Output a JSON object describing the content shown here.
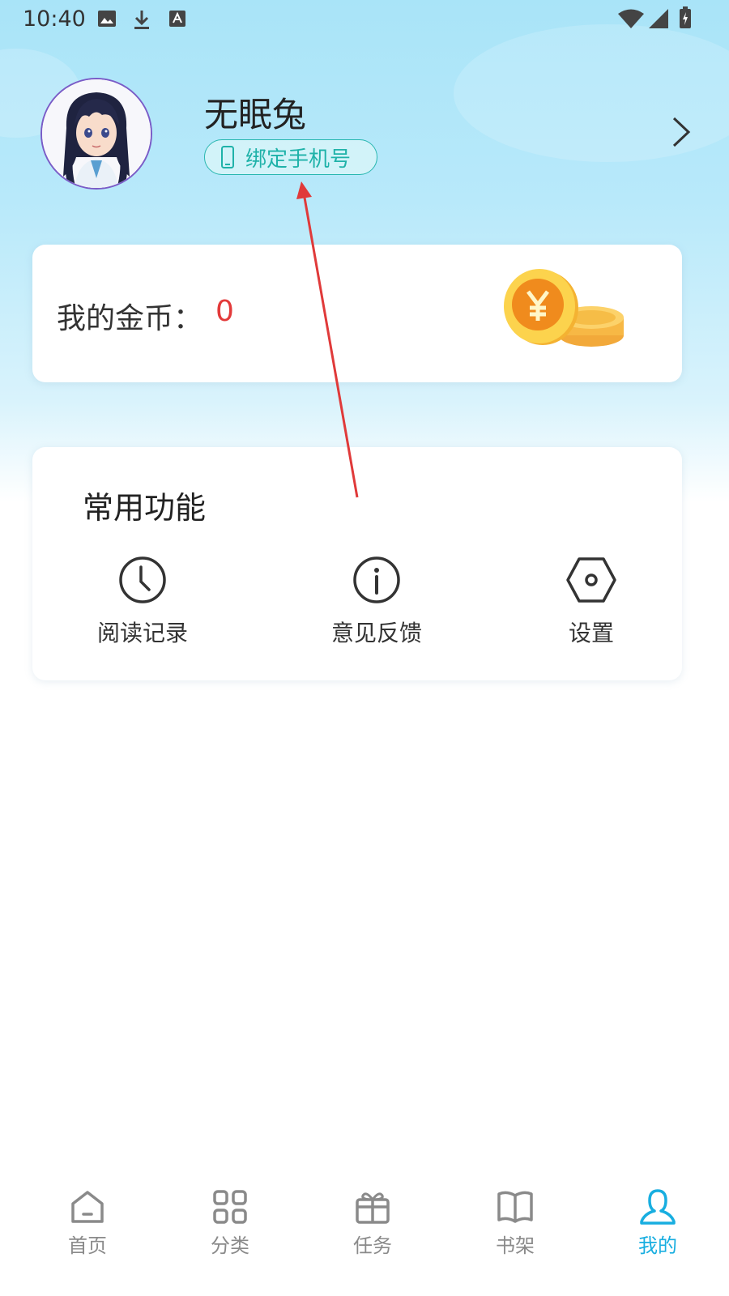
{
  "status_bar": {
    "time": "10:40",
    "left_icons": [
      "image-icon",
      "download-icon",
      "font-icon"
    ],
    "right_icons": [
      "wifi-icon",
      "signal-icon",
      "battery-icon"
    ]
  },
  "profile": {
    "username": "无眠兔",
    "bind_phone_label": "绑定手机号",
    "avatar_icon": "anime-girl-avatar"
  },
  "coins": {
    "label": "我的金币：",
    "value": "0",
    "value_color": "#e33a3a",
    "icon": "gold-coins-icon"
  },
  "functions": {
    "title": "常用功能",
    "items": [
      {
        "label": "阅读记录",
        "icon": "clock-icon"
      },
      {
        "label": "意见反馈",
        "icon": "info-icon"
      },
      {
        "label": "设置",
        "icon": "settings-hexagon-icon"
      }
    ]
  },
  "bottom_nav": {
    "active_color": "#18aee0",
    "items": [
      {
        "label": "首页",
        "icon": "home-icon",
        "active": false
      },
      {
        "label": "分类",
        "icon": "category-grid-icon",
        "active": false
      },
      {
        "label": "任务",
        "icon": "gift-icon",
        "active": false
      },
      {
        "label": "书架",
        "icon": "book-icon",
        "active": false
      },
      {
        "label": "我的",
        "icon": "user-icon",
        "active": true
      }
    ]
  },
  "colors": {
    "header_gradient_top": "#a9e4f8",
    "accent_teal": "#1fb2a9",
    "annotation_arrow": "#e03a3a"
  }
}
